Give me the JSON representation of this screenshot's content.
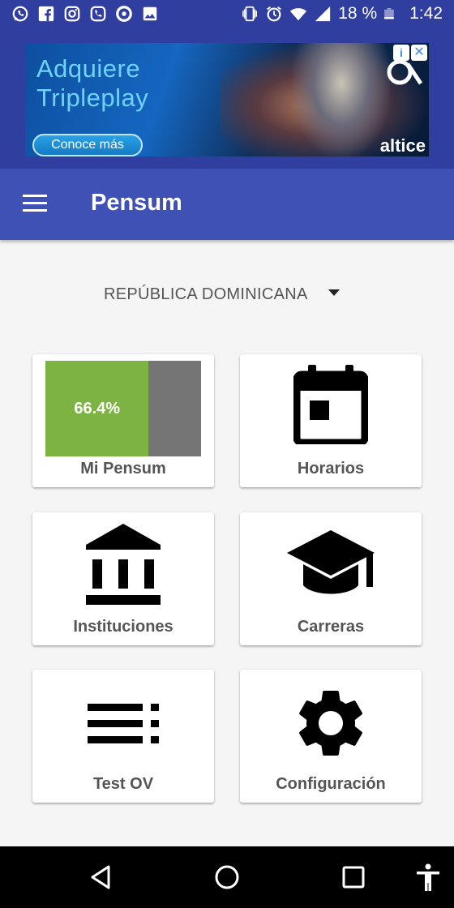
{
  "status_bar": {
    "battery": "18 %",
    "time": "1:42",
    "left_icons": [
      "whatsapp-icon",
      "facebook-icon",
      "instagram-icon",
      "viber-icon",
      "record-icon",
      "gallery-icon"
    ],
    "right_icons": [
      "vibrate-icon",
      "alarm-icon",
      "wifi-icon",
      "signal-icon",
      "battery-icon"
    ]
  },
  "ad": {
    "headline_line1": "Adquiere",
    "headline_line2": "Tripleplay",
    "cta": "Conoce más",
    "brand": "altice",
    "info_icon": "info-icon",
    "close_icon": "close-icon"
  },
  "app_bar": {
    "title": "Pensum",
    "menu_icon": "hamburger-menu-icon"
  },
  "country_selector": {
    "value": "REPÚBLICA DOMINICANA",
    "icon": "dropdown-arrow-icon"
  },
  "tiles": [
    {
      "label": "Mi Pensum",
      "progress_label": "66.4%",
      "progress_value": 0.664
    },
    {
      "label": "Horarios",
      "icon": "calendar-icon"
    },
    {
      "label": "Instituciones",
      "icon": "institution-icon"
    },
    {
      "label": "Carreras",
      "icon": "graduation-cap-icon"
    },
    {
      "label": "Test OV",
      "icon": "list-icon"
    },
    {
      "label": "Configuración",
      "icon": "gear-icon"
    }
  ],
  "nav_bar": {
    "icons": [
      "back-icon",
      "home-icon",
      "recents-icon",
      "accessibility-icon"
    ]
  },
  "colors": {
    "status_bar": "#303f9f",
    "primary": "#3f51b5",
    "progress_fill": "#7cb342",
    "progress_rest": "#757575",
    "background": "#f5f5f5"
  }
}
